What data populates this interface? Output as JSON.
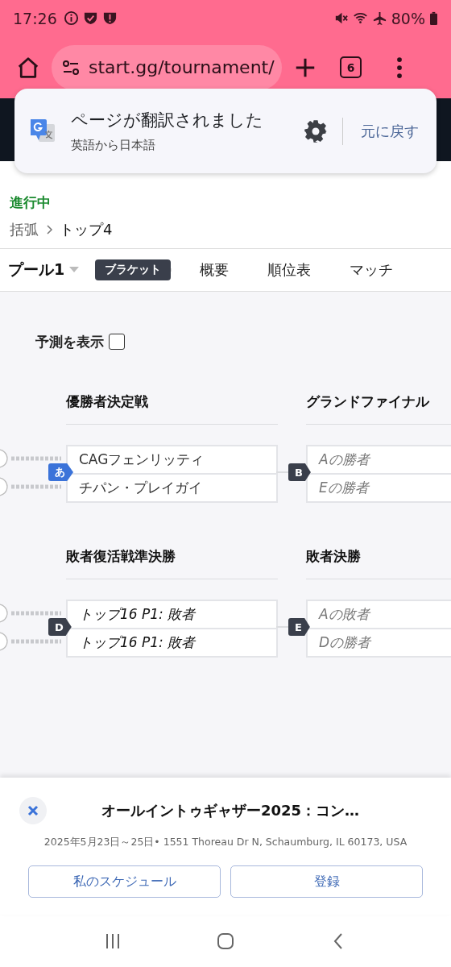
{
  "status_bar": {
    "time": "17:26",
    "battery": "80%"
  },
  "browser": {
    "url": "start.gg/tournament/",
    "tab_count": "6"
  },
  "translate_popup": {
    "title": "ページが翻訳されました",
    "subtitle": "英語から日本語",
    "undo": "元に戻す"
  },
  "event": {
    "status": "進行中",
    "breadcrumb": [
      "括弧",
      "トップ4"
    ]
  },
  "pool_selector": {
    "label": "プール1"
  },
  "tabs": [
    {
      "label": "ブラケット",
      "selected": true
    },
    {
      "label": "概要",
      "selected": false
    },
    {
      "label": "順位表",
      "selected": false
    },
    {
      "label": "マッチ",
      "selected": false
    }
  ],
  "predictions": {
    "label": "予測を表示",
    "checked": false
  },
  "bracket_rows": [
    {
      "columns": [
        {
          "title": "優勝者決定戦",
          "match": {
            "label": "あ",
            "highlighted": true,
            "entrants": [
              {
                "name": "CAGフェンリッティ",
                "kind": "player"
              },
              {
                "name": "チパン・プレイガイ",
                "kind": "player"
              }
            ]
          }
        },
        {
          "title": "グランドファイナル",
          "match": {
            "label": "B",
            "highlighted": false,
            "entrants": [
              {
                "name": "Aの勝者",
                "kind": "pending"
              },
              {
                "name": "Eの勝者",
                "kind": "pending"
              }
            ]
          }
        }
      ]
    },
    {
      "columns": [
        {
          "title": "敗者復活戦準決勝",
          "match": {
            "label": "D",
            "highlighted": false,
            "entrants": [
              {
                "name": "トップ16 P1: 敗者",
                "kind": "source"
              },
              {
                "name": "トップ16 P1: 敗者",
                "kind": "source"
              }
            ]
          }
        },
        {
          "title": "敗者決勝",
          "match": {
            "label": "E",
            "highlighted": false,
            "entrants": [
              {
                "name": "Aの敗者",
                "kind": "pending"
              },
              {
                "name": "Dの勝者",
                "kind": "pending"
              }
            ]
          }
        }
      ]
    }
  ],
  "event_sheet": {
    "title": "オールイントゥギャザー2025：コン…",
    "details": "2025年5月23日～25日• 1551 Thoreau Dr N, Schaumburg, IL 60173, USA",
    "buttons": [
      "私のスケジュール",
      "登録"
    ]
  }
}
